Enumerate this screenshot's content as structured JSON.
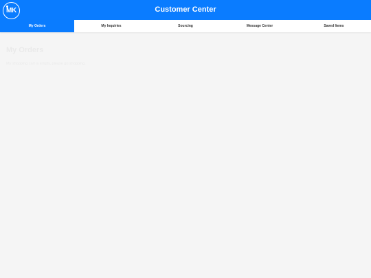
{
  "header": {
    "logo_text": "MK",
    "title": "Customer Center"
  },
  "tabs": [
    {
      "label": "My Orders",
      "active": true
    },
    {
      "label": "My Inquiries",
      "active": false
    },
    {
      "label": "Sourcing",
      "active": false
    },
    {
      "label": "Message Center",
      "active": false
    },
    {
      "label": "Saved Items",
      "active": false
    }
  ],
  "main": {
    "title": "My Orders",
    "subtitle": "My shopping cart is empty, please go shopping."
  },
  "colors": {
    "brand_blue": "#0a7cff",
    "background": "#f5f5f5"
  }
}
